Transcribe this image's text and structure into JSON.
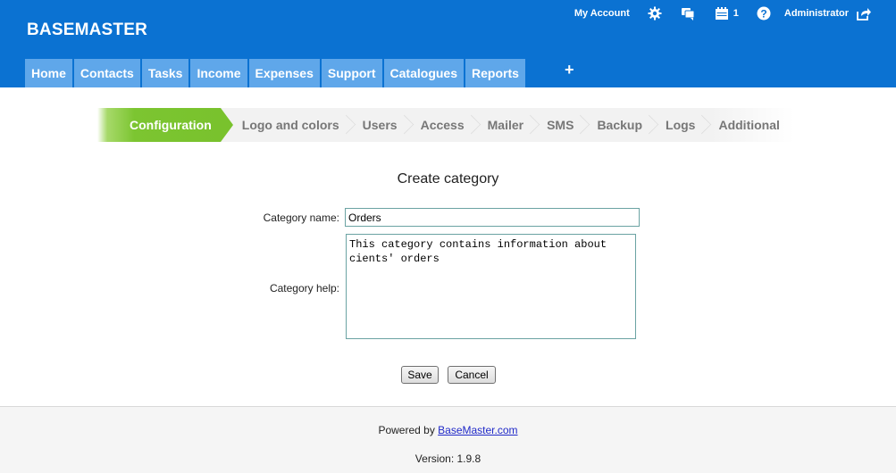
{
  "header": {
    "brand": "BASEMASTER",
    "my_account": "My Account",
    "calendar_count": "1",
    "user": "Administrator",
    "icons": [
      "gear-icon",
      "chat-icon",
      "calendar-icon",
      "help-icon",
      "logout-icon"
    ]
  },
  "nav": {
    "tabs": [
      {
        "label": "Home"
      },
      {
        "label": "Contacts"
      },
      {
        "label": "Tasks"
      },
      {
        "label": "Income"
      },
      {
        "label": "Expenses"
      },
      {
        "label": "Support"
      },
      {
        "label": "Catalogues"
      },
      {
        "label": "Reports"
      }
    ],
    "add_label": "+"
  },
  "steps": [
    {
      "label": "Configuration"
    },
    {
      "label": "Logo and colors"
    },
    {
      "label": "Users"
    },
    {
      "label": "Access"
    },
    {
      "label": "Mailer"
    },
    {
      "label": "SMS"
    },
    {
      "label": "Backup"
    },
    {
      "label": "Logs"
    },
    {
      "label": "Additional"
    }
  ],
  "form": {
    "title": "Create category",
    "name_label": "Category name:",
    "name_value": "Orders",
    "help_label": "Category help:",
    "help_value": "This category contains information about\ncients' orders",
    "save_label": "Save",
    "cancel_label": "Cancel"
  },
  "footer": {
    "powered_prefix": "Powered by ",
    "powered_link": "BaseMaster.com",
    "version": "Version: 1.9.8"
  },
  "colors": {
    "header_bg": "#0b72d2",
    "tab_bg": "#5fa7ea",
    "active_step": "#79c22d"
  }
}
